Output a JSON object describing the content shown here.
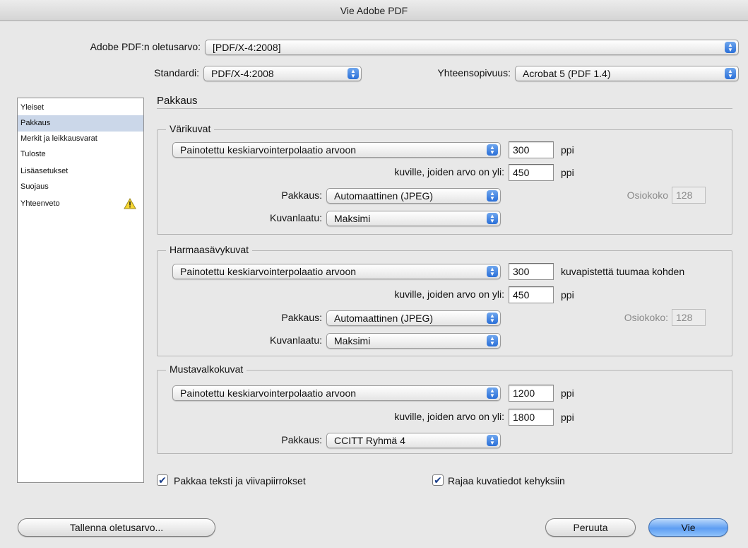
{
  "window": {
    "title": "Vie Adobe PDF"
  },
  "header": {
    "preset_label": "Adobe PDF:n oletusarvo:",
    "preset_value": "[PDF/X-4:2008]",
    "standard_label": "Standardi:",
    "standard_value": "PDF/X-4:2008",
    "compat_label": "Yhteensopivuus:",
    "compat_value": "Acrobat 5 (PDF 1.4)"
  },
  "sidebar": {
    "items": [
      {
        "label": "Yleiset"
      },
      {
        "label": "Pakkaus"
      },
      {
        "label": "Merkit ja leikkausvarat"
      },
      {
        "label": "Tuloste"
      },
      {
        "label": "Lisäasetukset"
      },
      {
        "label": "Suojaus"
      },
      {
        "label": "Yhteenveto"
      }
    ],
    "selected": "Pakkaus",
    "warning_icon": "warning-triangle-icon"
  },
  "pane": {
    "title": "Pakkaus"
  },
  "color": {
    "title": "Värikuvat",
    "method": "Painotettu keskiarvointerpolaatio arvoon",
    "res_value": "300",
    "res_unit": "ppi",
    "above_label": "kuville, joiden arvo on yli:",
    "above_value": "450",
    "above_unit": "ppi",
    "compression_label": "Pakkaus:",
    "compression_value": "Automaattinen (JPEG)",
    "tile_label": "Osiokoko",
    "tile_value": "128",
    "quality_label": "Kuvanlaatu:",
    "quality_value": "Maksimi"
  },
  "gray": {
    "title": "Harmaasävykuvat",
    "method": "Painotettu keskiarvointerpolaatio arvoon",
    "res_value": "300",
    "res_unit": "kuvapistettä tuumaa kohden",
    "above_label": "kuville, joiden arvo on yli:",
    "above_value": "450",
    "above_unit": "ppi",
    "compression_label": "Pakkaus:",
    "compression_value": "Automaattinen (JPEG)",
    "tile_label": "Osiokoko:",
    "tile_value": "128",
    "quality_label": "Kuvanlaatu:",
    "quality_value": "Maksimi"
  },
  "mono": {
    "title": "Mustavalkokuvat",
    "method": "Painotettu keskiarvointerpolaatio arvoon",
    "res_value": "1200",
    "res_unit": "ppi",
    "above_label": "kuville, joiden arvo on yli:",
    "above_value": "1800",
    "above_unit": "ppi",
    "compression_label": "Pakkaus:",
    "compression_value": "CCITT Ryhmä 4"
  },
  "options": {
    "compress_text_label": "Pakkaa teksti ja viivapiirrokset",
    "compress_text_checked": true,
    "crop_label": "Rajaa kuvatiedot kehyksiin",
    "crop_checked": true
  },
  "footer": {
    "save_preset_label": "Tallenna oletusarvo...",
    "cancel_label": "Peruuta",
    "export_label": "Vie"
  },
  "colors": {
    "selection": "#cbd7e9",
    "accent": "#2a6fd8",
    "background": "#e8e8e8"
  }
}
